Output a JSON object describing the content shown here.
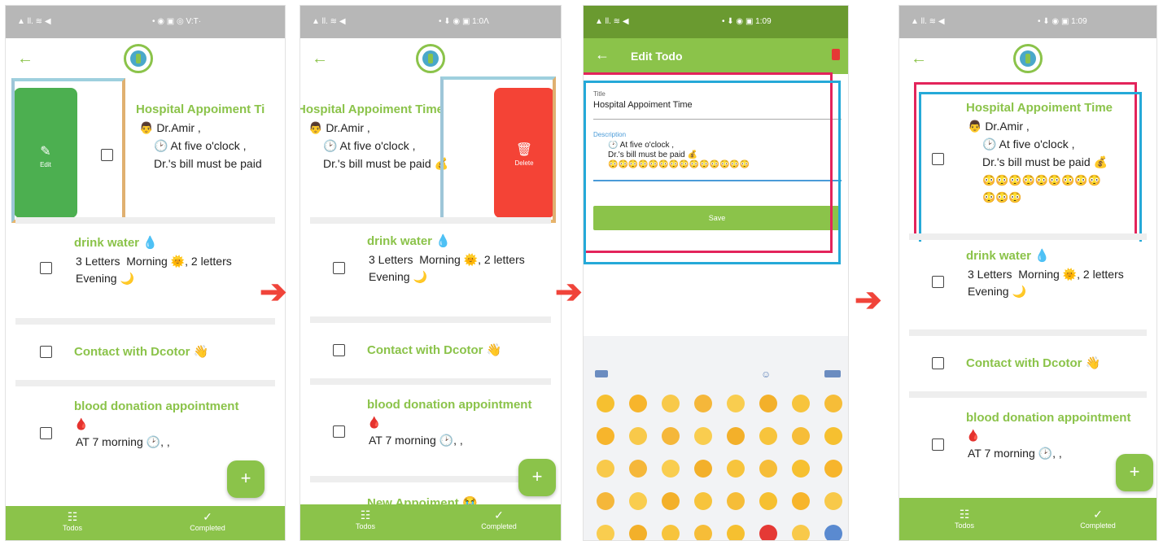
{
  "status": {
    "left": "▲ ll. ≋ ◀",
    "right_1": "• ◉ ▣ ◎ V:T·",
    "right_2": "• ⬇ ◉ ▣ 1:0Λ",
    "right_3": "• ⬇ ◉ ▣ 1:09",
    "right_4": "• ⬇ ◉ ▣ 1:09"
  },
  "todos": {
    "hospital_title": "Hospital Appoiment Time",
    "hospital_title_cut_1": "Hospital Appoiment Ti",
    "hospital_title_cut_2": "Hospital Appoiment Time",
    "hospital_desc_1": "👨 Dr.Amir ,",
    "hospital_desc_2": "🕑 At five o'clock ,",
    "hospital_desc_3": "Dr.'s bill must be paid 💰",
    "hospital_desc_cut_3": "Dr.'s bill must be paid",
    "hospital_emojis_1": "😳😳😳😳😳😳😳😳😳",
    "hospital_emojis_2": "😳😳😳",
    "water_title": "drink water 💧",
    "water_desc": "3 Letters  Morning 🌞, 2 letters\nEvening 🌙",
    "contact_title": "Contact with Dcotor 👋",
    "blood_title": "blood donation appointment",
    "blood_drop": "🩸",
    "blood_desc": "AT 7 morning 🕑, ,",
    "new_title": "New Appoiment 😭"
  },
  "swipe": {
    "edit_label": "Edit",
    "delete_label": "Delete"
  },
  "nav": {
    "todos": "Todos",
    "completed": "Completed"
  },
  "edit": {
    "title": "Edit Todo",
    "title_field_label": "Title",
    "title_value": "Hospital Appoiment Time",
    "desc_label": "Description",
    "desc_value": "🕑 At five o'clock ,\nDr.'s bill must be paid 💰\n😳😳😳😳😳😳😳😳😳😳😳😳😳😳",
    "save": "Save"
  },
  "colors": {
    "accent": "#8bc34a",
    "delete": "#f44336",
    "edit": "#4caf50",
    "highlight_red": "#e3245b",
    "highlight_blue": "#25a9d8"
  }
}
